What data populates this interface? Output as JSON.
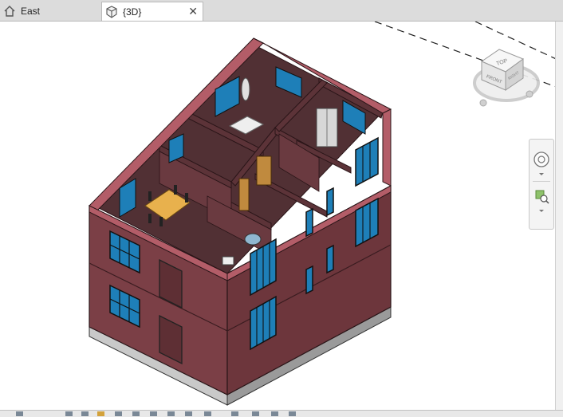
{
  "tabs": [
    {
      "label": "East",
      "icon": "elevation-house-icon",
      "active": false
    },
    {
      "label": "{3D}",
      "icon": "3d-view-cube-icon",
      "active": true,
      "close": "✕"
    }
  ],
  "viewcube": {
    "top_label": "TOP",
    "front_label": "FRONT",
    "right_label": "RIGHT"
  },
  "navbar": {
    "tools": [
      "full-navigation-wheel-icon",
      "zoom-region-icon"
    ]
  },
  "colors": {
    "wall_exterior": "#7b3f46",
    "wall_top": "#b35d68",
    "floor_interior": "#513034",
    "window_glass": "#1e7fb8",
    "table_wood": "#e8b14d",
    "tab_active": "#ffffff",
    "tab_bar": "#dcdcdc"
  },
  "statusbar": {
    "icons": [
      "scale-icon",
      "detail-level-icon",
      "visual-style-icon",
      "sun-path-icon",
      "shadows-icon",
      "render-icon",
      "crop-icon",
      "show-crop-icon",
      "unlock-3d-icon",
      "temporary-hide-icon",
      "reveal-hidden-icon",
      "analytical-model-icon",
      "highlight-displacement-icon",
      "constraints-icon"
    ]
  }
}
